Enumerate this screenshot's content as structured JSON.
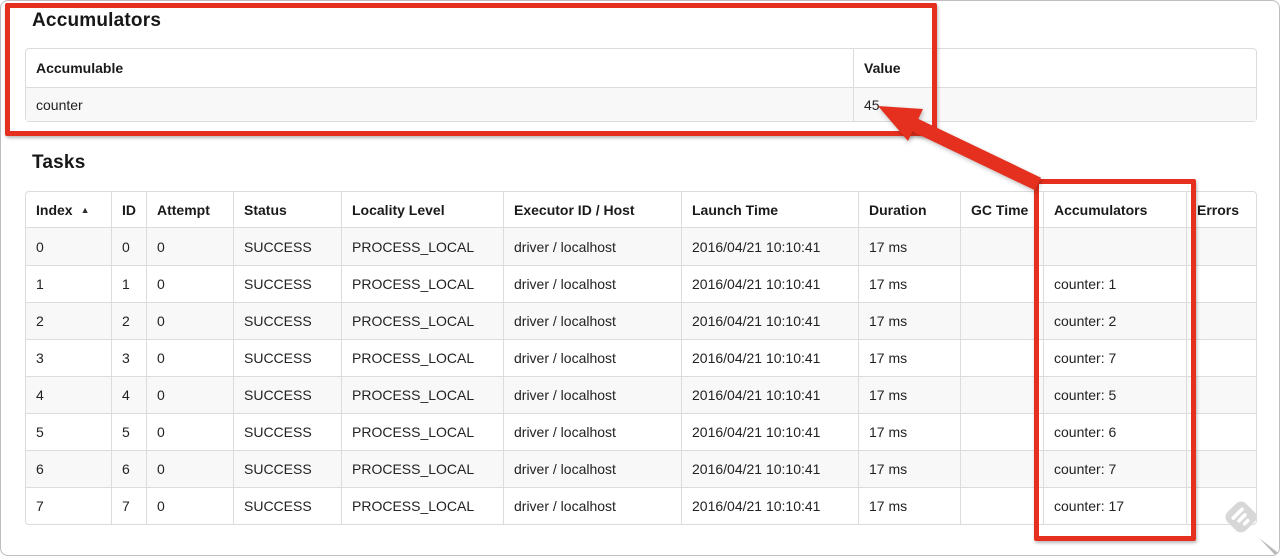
{
  "colors": {
    "annotation_red": "#e5301f"
  },
  "accumulators_section": {
    "heading": "Accumulators",
    "table": {
      "columns": [
        "Accumulable",
        "Value"
      ],
      "rows": [
        [
          "counter",
          "45"
        ]
      ]
    }
  },
  "tasks_section": {
    "heading": "Tasks",
    "table": {
      "columns": [
        "Index",
        "ID",
        "Attempt",
        "Status",
        "Locality Level",
        "Executor ID / Host",
        "Launch Time",
        "Duration",
        "GC Time",
        "Accumulators",
        "Errors"
      ],
      "sort": {
        "column_index": 0,
        "icon": "▲",
        "direction": "ascending"
      },
      "rows": [
        [
          "0",
          "0",
          "0",
          "SUCCESS",
          "PROCESS_LOCAL",
          "driver / localhost",
          "2016/04/21 10:10:41",
          "17 ms",
          "",
          "",
          ""
        ],
        [
          "1",
          "1",
          "0",
          "SUCCESS",
          "PROCESS_LOCAL",
          "driver / localhost",
          "2016/04/21 10:10:41",
          "17 ms",
          "",
          "counter: 1",
          ""
        ],
        [
          "2",
          "2",
          "0",
          "SUCCESS",
          "PROCESS_LOCAL",
          "driver / localhost",
          "2016/04/21 10:10:41",
          "17 ms",
          "",
          "counter: 2",
          ""
        ],
        [
          "3",
          "3",
          "0",
          "SUCCESS",
          "PROCESS_LOCAL",
          "driver / localhost",
          "2016/04/21 10:10:41",
          "17 ms",
          "",
          "counter: 7",
          ""
        ],
        [
          "4",
          "4",
          "0",
          "SUCCESS",
          "PROCESS_LOCAL",
          "driver / localhost",
          "2016/04/21 10:10:41",
          "17 ms",
          "",
          "counter: 5",
          ""
        ],
        [
          "5",
          "5",
          "0",
          "SUCCESS",
          "PROCESS_LOCAL",
          "driver / localhost",
          "2016/04/21 10:10:41",
          "17 ms",
          "",
          "counter: 6",
          ""
        ],
        [
          "6",
          "6",
          "0",
          "SUCCESS",
          "PROCESS_LOCAL",
          "driver / localhost",
          "2016/04/21 10:10:41",
          "17 ms",
          "",
          "counter: 7",
          ""
        ],
        [
          "7",
          "7",
          "0",
          "SUCCESS",
          "PROCESS_LOCAL",
          "driver / localhost",
          "2016/04/21 10:10:41",
          "17 ms",
          "",
          "counter: 17",
          ""
        ]
      ]
    }
  },
  "annotations": {
    "box_around_accumulators_section": true,
    "box_around_tasks_accumulators_column": true,
    "arrow_from_column_to_value": "points at 45"
  },
  "icons": {
    "sort_ascending": "▲",
    "watermark": "feedly-watermark-icon",
    "cursor_fragment": "pointer-fragment-icon"
  }
}
